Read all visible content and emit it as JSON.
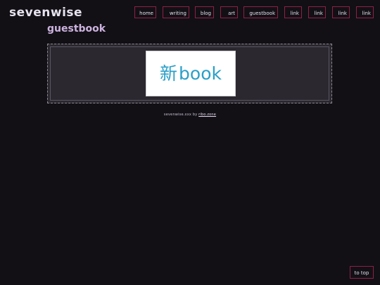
{
  "site": {
    "title": "sevenwise"
  },
  "nav": [
    {
      "label": "home"
    },
    {
      "label": "writing"
    },
    {
      "label": "blog"
    },
    {
      "label": "art"
    },
    {
      "label": "guestbook"
    },
    {
      "label": "link"
    },
    {
      "label": "link"
    },
    {
      "label": "link"
    },
    {
      "label": "link"
    }
  ],
  "page": {
    "title": "guestbook"
  },
  "guestbook": {
    "banner_kanji": "新",
    "banner_text": "book"
  },
  "footer": {
    "prefix": "sevenwise.xxx by",
    "link_text": "ribo.zone"
  },
  "to_top": {
    "label": "to top"
  },
  "colors": {
    "background": "#121015",
    "accent_border": "#8f1f45",
    "title_color": "#e7e3ee",
    "page_title_color": "#cdb3df",
    "banner_text_color": "#2a9fc8"
  }
}
